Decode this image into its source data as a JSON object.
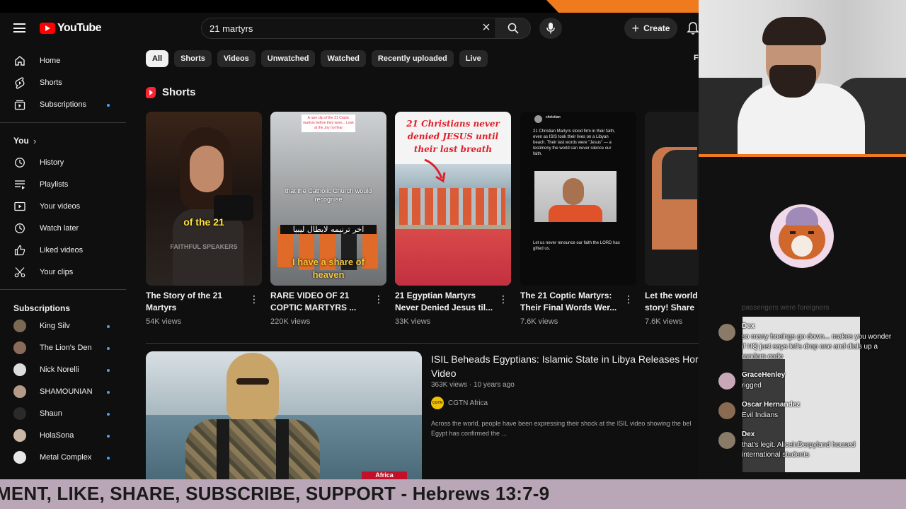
{
  "youtube": {
    "logo_text": "YouTube",
    "search": {
      "query": "21 martyrs"
    },
    "create_label": "Create",
    "sidebar": {
      "main": [
        {
          "label": "Home",
          "icon": "home-icon"
        },
        {
          "label": "Shorts",
          "icon": "shorts-icon"
        },
        {
          "label": "Subscriptions",
          "icon": "subscriptions-icon"
        }
      ],
      "you_header": "You",
      "you": [
        {
          "label": "History",
          "icon": "history-icon"
        },
        {
          "label": "Playlists",
          "icon": "playlists-icon"
        },
        {
          "label": "Your videos",
          "icon": "your-videos-icon"
        },
        {
          "label": "Watch later",
          "icon": "watch-later-icon"
        },
        {
          "label": "Liked videos",
          "icon": "liked-videos-icon"
        },
        {
          "label": "Your clips",
          "icon": "scissors-icon"
        }
      ],
      "subs_header": "Subscriptions",
      "subscriptions": [
        {
          "name": "King Silv",
          "color": "#7a6a55"
        },
        {
          "name": "The Lion's Den",
          "color": "#8a6b5a"
        },
        {
          "name": "Nick Norelli",
          "color": "#dddddd"
        },
        {
          "name": "SHAMOUNIAN",
          "color": "#b59a8a"
        },
        {
          "name": "Shaun",
          "color": "#2a2a2a"
        },
        {
          "name": "HolaSona",
          "color": "#c9b8a8"
        },
        {
          "name": "Metal Complex",
          "color": "#e8e8e8"
        }
      ]
    },
    "chips": [
      "All",
      "Shorts",
      "Videos",
      "Unwatched",
      "Watched",
      "Recently uploaded",
      "Live"
    ],
    "chip_more": "F",
    "shorts_header": "Shorts",
    "shorts": [
      {
        "title": "The Story of the 21 Martyrs",
        "views": "54K views",
        "overlay": "of the 21",
        "watermark": "FAITHFUL SPEAKERS"
      },
      {
        "title": "RARE VIDEO OF 21 COPTIC MARTYRS ...",
        "views": "220K views",
        "top_caption": "A rare clip of the 21 Coptic martyrs before they were... Look at the Joy not fear",
        "overlay1": "that the Catholic Church would recognise",
        "overlay2": "اخر ترنيمه لابطال ليبيا",
        "overlay3": "I have a share of heaven"
      },
      {
        "title": "21 Egyptian Martyrs Never Denied Jesus til...",
        "views": "33K views",
        "overlay": "21 Christians never denied JESUS until their last breath"
      },
      {
        "title": "The 21 Coptic Martyrs: Their Final Words Wer...",
        "views": "7.6K views",
        "tweet_user": "christian",
        "tweet_text": "21 Christian Martyrs stood firm in their faith, even as ISIS took their lives on a Libyan beach. Their last words were \"Jesus\" — a testimony the world can never silence our faith.",
        "tweet_text2": "Let us never renounce our faith the LORD has gifted us."
      },
      {
        "title": "Let the world story! Share",
        "views": "7.6K views"
      }
    ],
    "video": {
      "title_line1": "ISIL Beheads Egyptians: Islamic State in Libya Releases Horri",
      "title_line2": "Video",
      "meta": "363K views · 10 years ago",
      "channel": "CGTN Africa",
      "channel_avatar_text": "CGTN",
      "description_line1": "Across the world, people have been expressing their shock at the ISIL video showing the bel",
      "description_line2": "Egypt has confirmed the ...",
      "thumb_badge": "Africa"
    }
  },
  "overlay": {
    "faded_text": "passengers were foreigners",
    "chat": [
      {
        "user": "Dex",
        "text": "so many boeings go down... makes you wonder if HQ just says let's drop one and dials up a random code",
        "avatar_color": "#8a7a68"
      },
      {
        "user": "GraceHenley",
        "text": "rigged",
        "avatar_color": "#c8a8b8"
      },
      {
        "user": "Oscar Hernandez",
        "text": "Evil Indians",
        "avatar_color": "#8a6a50"
      },
      {
        "user": "Dex",
        "text": "that's legit. AliceinDerpyland housed international students",
        "avatar_color": "#8a7a68"
      }
    ],
    "ticker": "MENT, LIKE, SHARE, SUBSCRIBE, SUPPORT - Hebrews 13:7-9"
  }
}
